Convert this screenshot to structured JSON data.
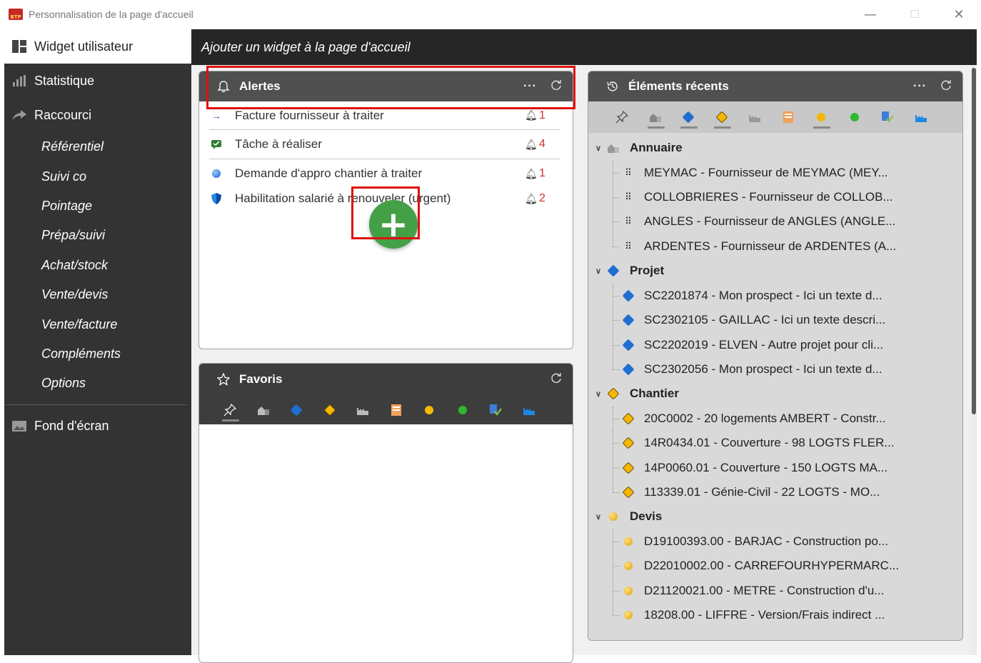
{
  "window": {
    "title": "Personnalisation de la page d'accueil",
    "logo_text": "BTP",
    "controls": {
      "minimize": "—",
      "maximize": "☐",
      "close": "✕"
    }
  },
  "sidebar": {
    "active_item": "Widget utilisateur",
    "items": {
      "statistique": "Statistique",
      "raccourci": "Raccourci",
      "fond_ecran": "Fond d'écran"
    },
    "sub_items": [
      "Référentiel",
      "Suivi co",
      "Pointage",
      "Prépa/suivi",
      "Achat/stock",
      "Vente/devis",
      "Vente/facture",
      "Compléments",
      "Options"
    ]
  },
  "header": {
    "title": "Ajouter un widget à la page d'accueil"
  },
  "alertes": {
    "title": "Alertes",
    "more": "···",
    "rows": [
      {
        "text": "Facture fournisseur à traiter",
        "count": "1"
      },
      {
        "text": "Tâche à réaliser",
        "count": "4"
      },
      {
        "text": "Demande d'appro chantier à traiter",
        "count": "1"
      },
      {
        "text": "Habilitation salarié à renouveler (urgent)",
        "count": "2"
      }
    ],
    "add_symbol": "+"
  },
  "favoris": {
    "title": "Favoris"
  },
  "recents": {
    "title": "Éléments récents",
    "more": "···",
    "groups": [
      {
        "label": "Annuaire",
        "items": [
          "MEYMAC - Fournisseur de MEYMAC (MEY...",
          "COLLOBRIERES - Fournisseur de COLLOB...",
          "ANGLES - Fournisseur de ANGLES (ANGLE...",
          "ARDENTES - Fournisseur de ARDENTES (A..."
        ]
      },
      {
        "label": "Projet",
        "items": [
          "SC2201874 - Mon prospect - Ici un texte d...",
          "SC2302105 - GAILLAC - Ici un texte descri...",
          "SC2202019 - ELVEN - Autre projet pour cli...",
          "SC2302056 - Mon prospect - Ici un texte d..."
        ]
      },
      {
        "label": "Chantier",
        "items": [
          "20C0002 - 20 logements AMBERT - Constr...",
          "14R0434.01 - Couverture - 98 LOGTS FLER...",
          "14P0060.01 - Couverture - 150 LOGTS MA...",
          "113339.01 - Génie-Civil - 22 LOGTS - MO..."
        ]
      },
      {
        "label": "Devis",
        "items": [
          "D19100393.00 - BARJAC - Construction po...",
          "D22010002.00 - CARREFOURHYPERMARC...",
          "D21120021.00 - METRE - Construction d'u...",
          "18208.00 - LIFFRE - Version/Frais indirect ..."
        ]
      }
    ]
  },
  "colors": {
    "sidebar_bg": "#333333",
    "header_bg": "#262626",
    "widget_head_dark": "#3d3d3d",
    "widget_head_gray": "#505050",
    "highlight_red": "#e01010",
    "add_green": "#43a047",
    "alert_count_red": "#d32f2f"
  }
}
